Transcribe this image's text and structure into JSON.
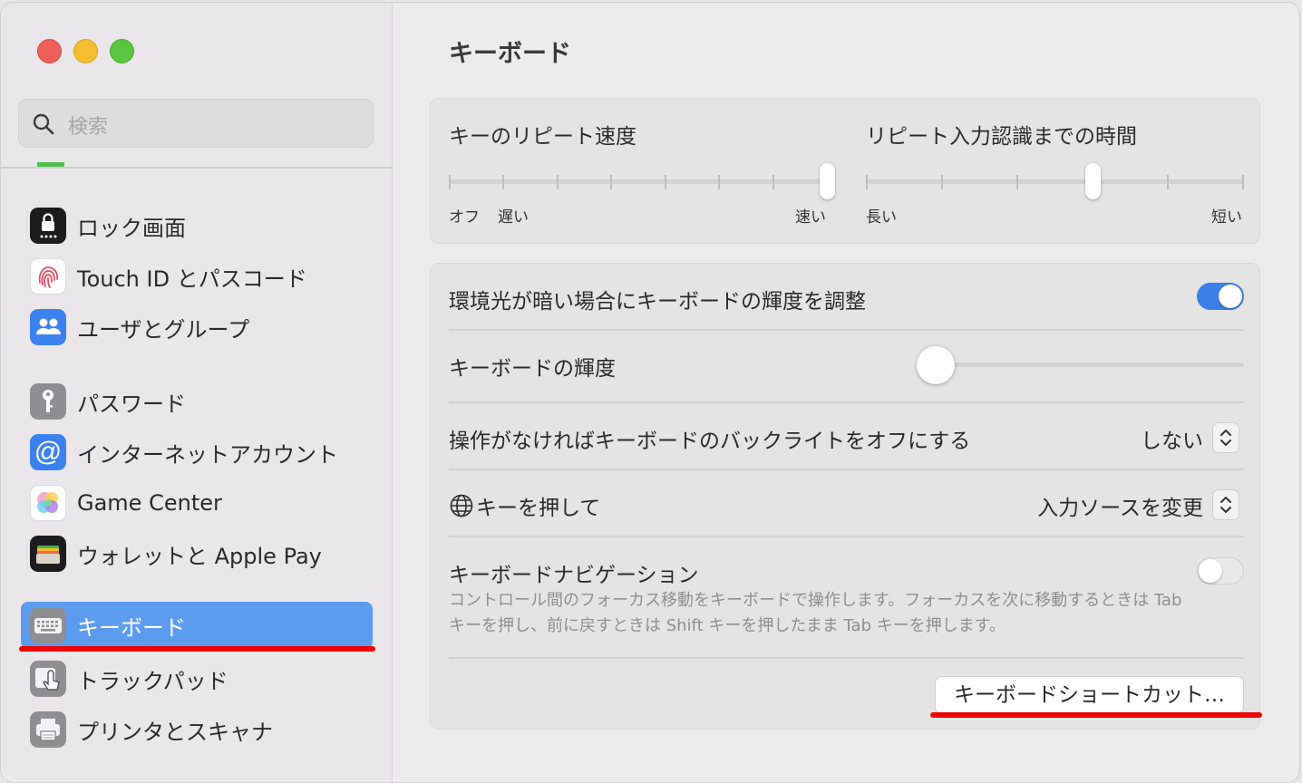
{
  "sidebar": {
    "search_placeholder": "検索",
    "items": [
      {
        "label": "ロック画面",
        "icon": "lock-screen-icon"
      },
      {
        "label": "Touch ID とパスコード",
        "icon": "fingerprint-icon"
      },
      {
        "label": "ユーザとグループ",
        "icon": "users-icon"
      },
      {
        "label": "パスワード",
        "icon": "key-icon"
      },
      {
        "label": "インターネットアカウント",
        "icon": "at-icon"
      },
      {
        "label": "Game Center",
        "icon": "game-center-icon"
      },
      {
        "label": "ウォレットと Apple Pay",
        "icon": "wallet-icon"
      },
      {
        "label": "キーボード",
        "icon": "keyboard-icon",
        "selected": true
      },
      {
        "label": "トラックパッド",
        "icon": "trackpad-icon"
      },
      {
        "label": "プリンタとスキャナ",
        "icon": "printer-icon"
      }
    ]
  },
  "main": {
    "title": "キーボード",
    "repeat_speed": {
      "label": "キーのリピート速度",
      "min_label_1": "オフ",
      "min_label_2": "遅い",
      "max_label": "速い",
      "value_step": 7,
      "steps": 8
    },
    "repeat_delay": {
      "label": "リピート入力認識までの時間",
      "min_label": "長い",
      "max_label": "短い",
      "value_step": 3,
      "steps": 6
    },
    "ambient_adjust": {
      "label": "環境光が暗い場合にキーボードの輝度を調整",
      "on": true
    },
    "brightness": {
      "label": "キーボードの輝度",
      "value": 0
    },
    "backlight_off": {
      "label": "操作がなければキーボードのバックライトをオフにする",
      "value": "しない"
    },
    "globe_key": {
      "label": "キーを押して",
      "value": "入力ソースを変更"
    },
    "keyboard_nav": {
      "label": "キーボードナビゲーション",
      "on": false,
      "description": "コントロール間のフォーカス移動をキーボードで操作します。フォーカスを次に移動するときは Tab キーを押し、前に戻すときは Shift キーを押したまま Tab キーを押します。"
    },
    "shortcuts_button": "キーボードショートカット…"
  },
  "colors": {
    "accent": "#3b80e8",
    "selection": "#5c9cf0",
    "annotation": "#ee0000"
  }
}
